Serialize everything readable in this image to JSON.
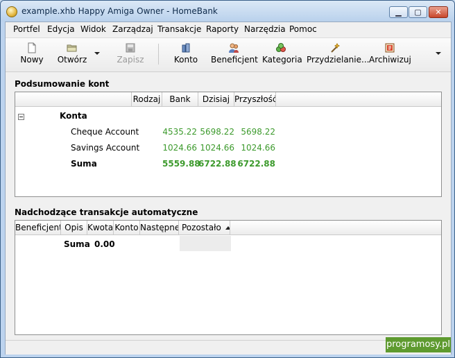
{
  "window": {
    "title": "example.xhb Happy Amiga Owner - HomeBank",
    "minimize_glyph": "▁",
    "maximize_glyph": "▢",
    "close_glyph": "✕"
  },
  "menu": [
    {
      "label": "Portfel"
    },
    {
      "label": "Edycja"
    },
    {
      "label": "Widok"
    },
    {
      "label": "Zarządzaj"
    },
    {
      "label": "Transakcje"
    },
    {
      "label": "Raporty"
    },
    {
      "label": "Narzędzia"
    },
    {
      "label": "Pomoc"
    }
  ],
  "toolbar": {
    "new": "Nowy",
    "open": "Otwórz",
    "save": "Zapisz",
    "account": "Konto",
    "payee": "Beneficjent",
    "category": "Kategoria",
    "assign": "Przydzielanie...",
    "archive": "Archiwizuj"
  },
  "accounts_summary": {
    "title": "Podsumowanie kont",
    "columns": [
      "",
      "Rodzaj",
      "Bank",
      "Dzisiaj",
      "Przyszłość"
    ],
    "group_label": "Konta",
    "rows": [
      {
        "name": "Cheque Account",
        "bank": "4535.22",
        "today": "5698.22",
        "future": "5698.22"
      },
      {
        "name": "Savings Account",
        "bank": "1024.66",
        "today": "1024.66",
        "future": "1024.66"
      }
    ],
    "total": {
      "name": "Suma",
      "bank": "5559.88",
      "today": "6722.88",
      "future": "6722.88"
    }
  },
  "scheduled": {
    "title": "Nadchodzące transakcje automatyczne",
    "columns": [
      "Beneficjent",
      "Opis",
      "Kwota",
      "Konto",
      "Następne",
      "Pozostało"
    ],
    "total": {
      "label": "Suma",
      "amount": "0.00"
    }
  },
  "watermark": "programosy.pl",
  "colors": {
    "positive": "#3c9a2c",
    "badge": "#5e9a2f"
  }
}
